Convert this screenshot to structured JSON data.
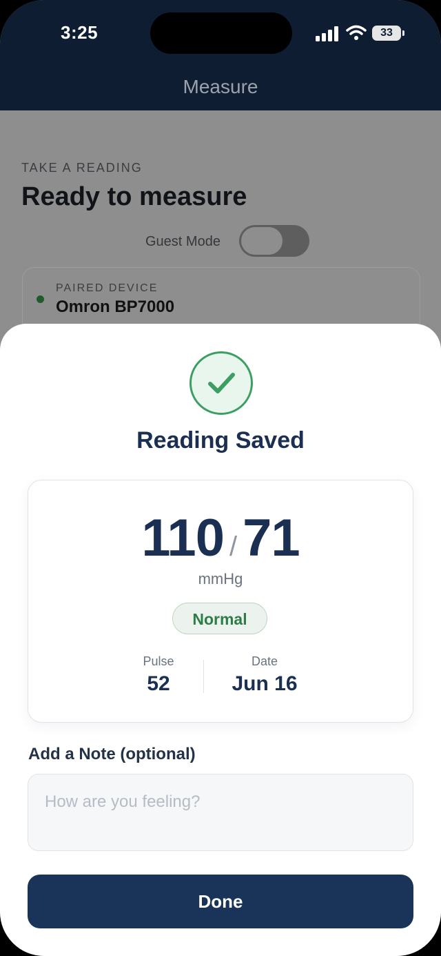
{
  "status_bar": {
    "time": "3:25",
    "battery": "33"
  },
  "nav": {
    "title": "Measure"
  },
  "background": {
    "eyebrow": "TAKE A READING",
    "heading": "Ready to measure",
    "guest_mode_label": "Guest Mode",
    "guest_mode_on": false,
    "device": {
      "eyebrow": "PAIRED DEVICE",
      "name": "Omron BP7000"
    }
  },
  "modal": {
    "title": "Reading Saved",
    "reading": {
      "systolic": "110",
      "separator": "/",
      "diastolic": "71",
      "unit": "mmHg",
      "status": "Normal",
      "pulse_label": "Pulse",
      "pulse_value": "52",
      "date_label": "Date",
      "date_value": "Jun 16"
    },
    "note": {
      "label": "Add a Note (optional)",
      "placeholder": "How are you feeling?",
      "value": ""
    },
    "done_label": "Done"
  },
  "colors": {
    "header_bg": "#0f1d33",
    "accent_navy": "#1a3358",
    "success_green": "#3c9e62",
    "status_green": "#2f7d46"
  }
}
